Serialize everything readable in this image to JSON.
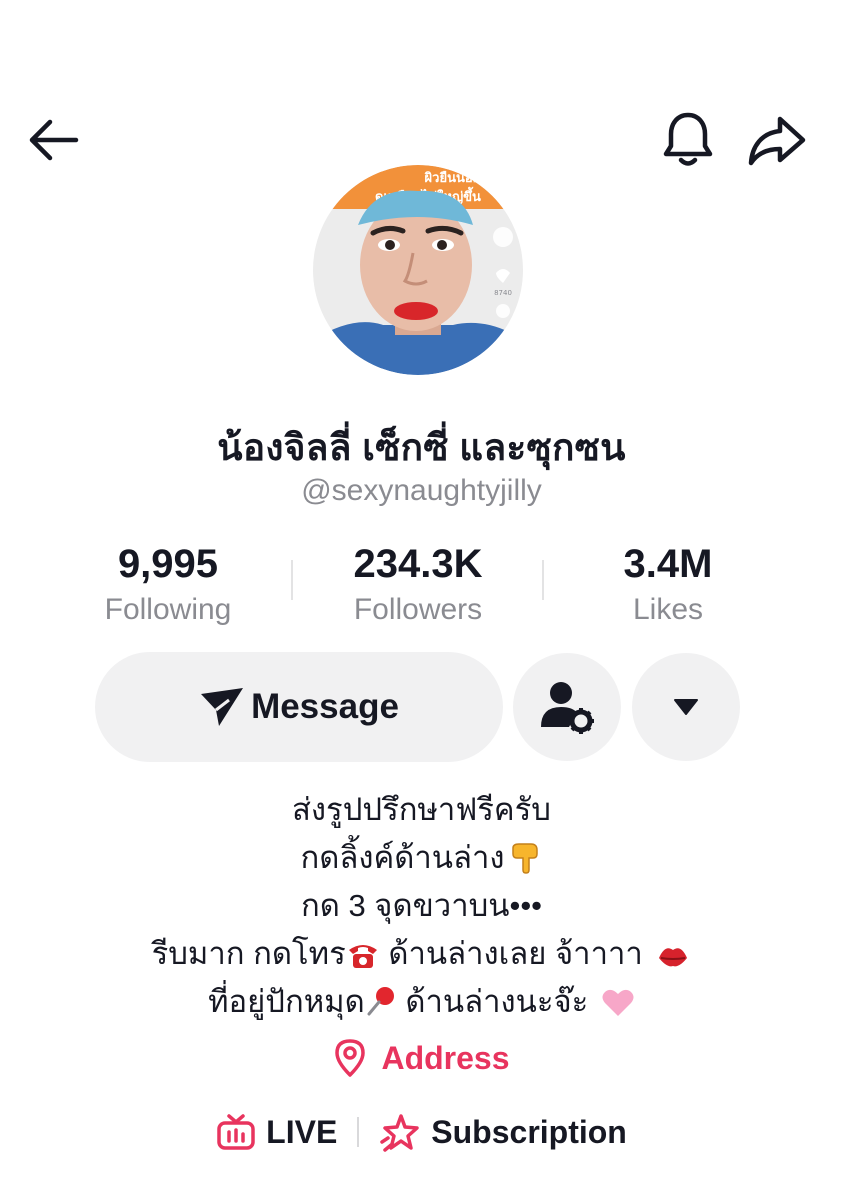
{
  "header": {
    "back_icon": "arrow-left-icon",
    "bell_icon": "bell-icon",
    "share_icon": "share-arrow-icon"
  },
  "profile": {
    "avatar_caption_1": "ผิวยืนน้อยเกิน",
    "avatar_caption_2": "ดูเหมือนไข่ใหญ่ขึ้น",
    "avatar_like_count": "8740",
    "display_name": "น้องจิลลี่ เซ็กซี่ และซุกซน",
    "username": "@sexynaughtyjilly"
  },
  "stats": [
    {
      "value": "9,995",
      "label": "Following"
    },
    {
      "value": "234.3K",
      "label": "Followers"
    },
    {
      "value": "3.4M",
      "label": "Likes"
    }
  ],
  "actions": {
    "message_label": "Message",
    "message_icon": "send-icon",
    "friend_settings_icon": "user-gear-icon",
    "more_icon": "caret-down-icon"
  },
  "bio": {
    "line1": "ส่งรูปปรึกษาฟรีครับ",
    "line2": "กดลิ้งค์ด้านล่าง",
    "line2_emoji": "pointing-down-icon",
    "line3": "กด 3 จุดขวาบน•••",
    "line4_a": "รีบมาก กดโทร",
    "line4_b": " ด้านล่างเลย จ้าาาา ",
    "line4_emoji1": "telephone-icon",
    "line4_emoji2": "lips-kiss-icon",
    "line5_a": "ที่อยู่ปักหมุด",
    "line5_b": " ด้านล่างนะจ๊ะ ",
    "line5_emoji1": "pushpin-icon",
    "line5_emoji2": "pink-heart-icon"
  },
  "address": {
    "label": "Address",
    "icon": "location-pin-icon"
  },
  "links": {
    "live_label": "LIVE",
    "live_icon": "live-tv-icon",
    "subscription_label": "Subscription",
    "subscription_icon": "star-sparkle-icon"
  },
  "colors": {
    "accent": "#e8345e",
    "text": "#161823",
    "secondary_text": "#8a8b91",
    "button_bg": "#f1f1f2"
  }
}
